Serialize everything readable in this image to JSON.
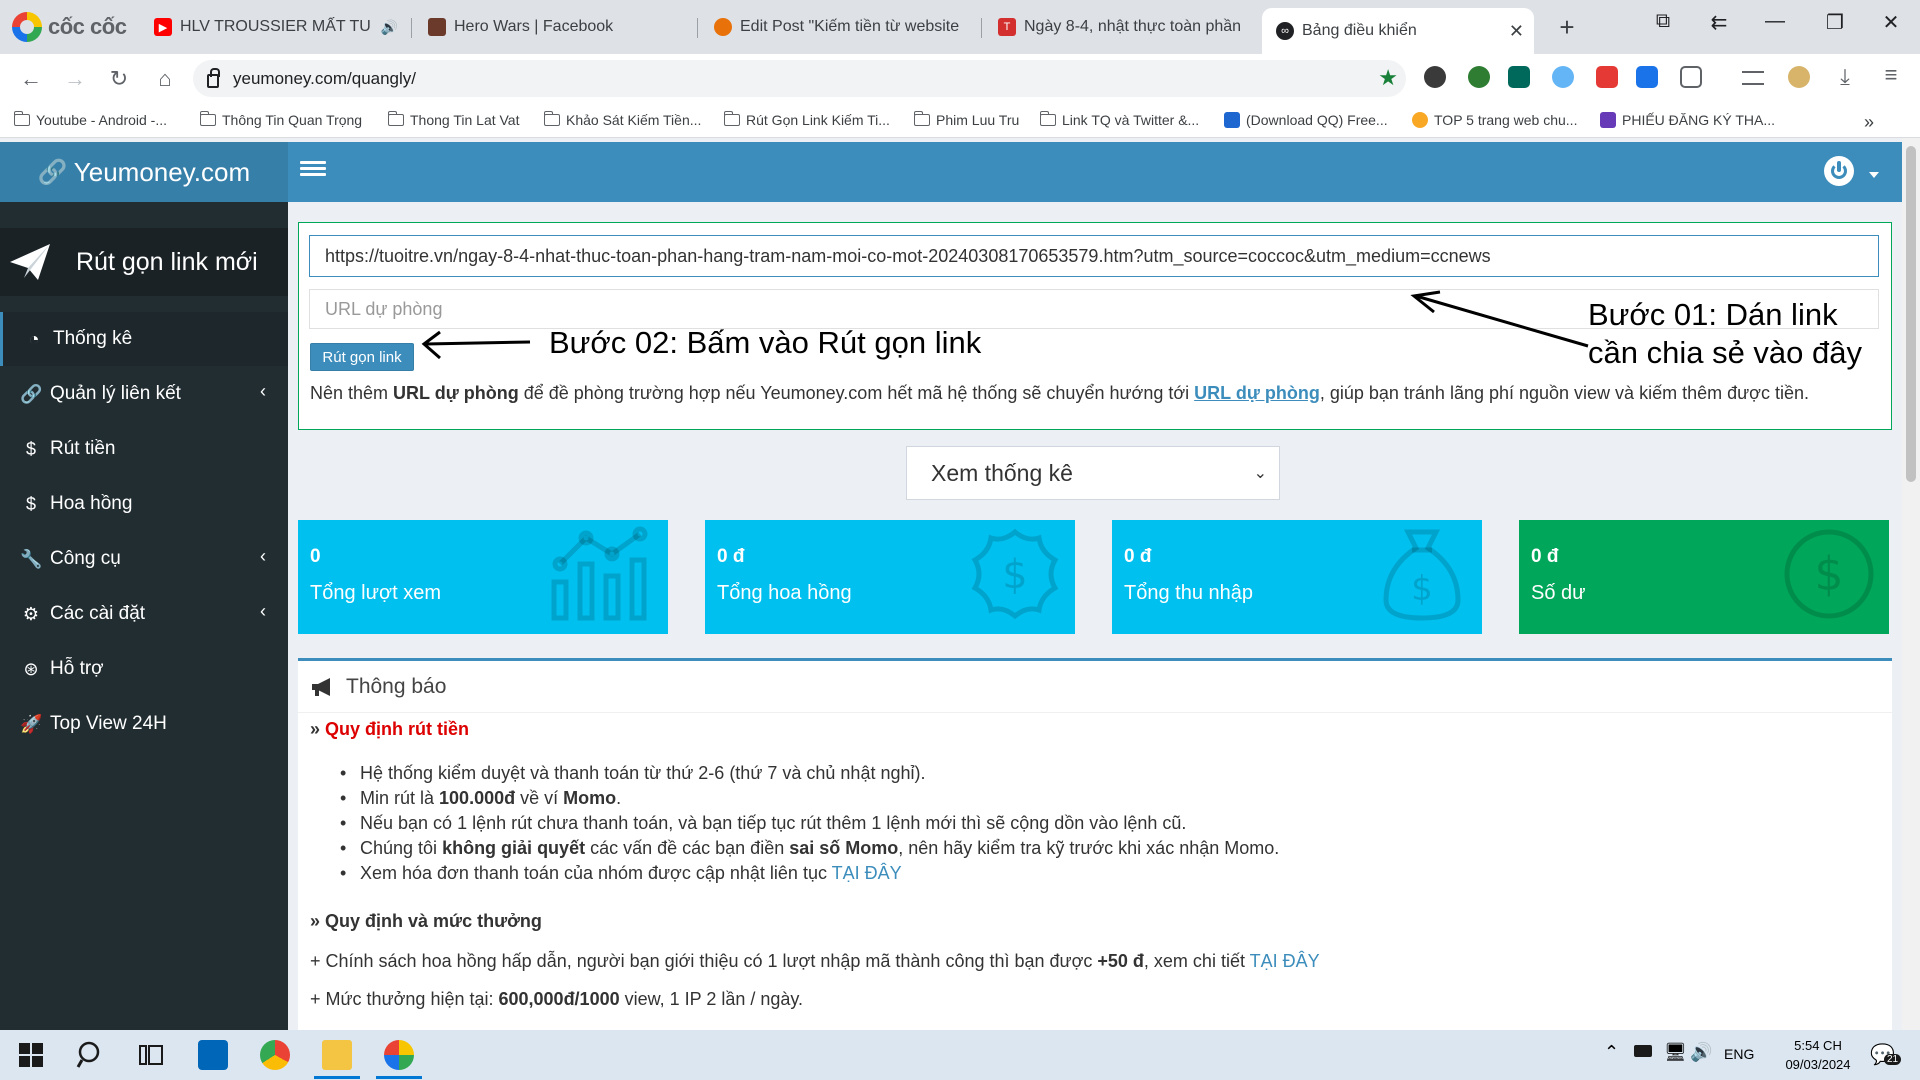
{
  "browser": {
    "brand": "cốc cốc",
    "tabs": [
      {
        "label": "HLV TROUSSIER MẤT TU",
        "icon": "youtube-icon"
      },
      {
        "label": "Hero Wars | Facebook",
        "icon": "hero-wars-icon"
      },
      {
        "label": "Edit Post \"Kiếm tiền từ website",
        "icon": "edit-post-icon"
      },
      {
        "label": "Ngày 8-4, nhật thực toàn phần",
        "icon": "tuoitre-icon"
      },
      {
        "label": "Bảng điều khiển",
        "icon": "yeumoney-icon"
      }
    ],
    "url": "yeumoney.com/quangly/",
    "bookmarks": [
      "Youtube - Android -...",
      "Thông Tin Quan Trọng",
      "Thong Tin Lat Vat",
      "Khảo Sát Kiếm Tiền...",
      "Rút Gọn Link Kiếm Ti...",
      "Phim Luu Tru",
      "Link TQ và Twitter &...",
      "(Download QQ) Free...",
      "TOP 5 trang web chu...",
      "PHIẾU ĐĂNG KÝ THA..."
    ]
  },
  "site": {
    "logo": "Yeumoney.com",
    "new_link": "Rút gọn link mới",
    "menu": [
      {
        "label": "Thống kê",
        "icon": "dashboard-icon",
        "active": true
      },
      {
        "label": "Quản lý liên kết",
        "icon": "link-icon",
        "has_arrow": true
      },
      {
        "label": "Rút tiền",
        "icon": "dollar-icon"
      },
      {
        "label": "Hoa hồng",
        "icon": "dollar-icon"
      },
      {
        "label": "Công cụ",
        "icon": "wrench-icon",
        "has_arrow": true
      },
      {
        "label": "Các cài đặt",
        "icon": "gears-icon",
        "has_arrow": true
      },
      {
        "label": "Hỗ trợ",
        "icon": "lifering-icon"
      },
      {
        "label": "Top View 24H",
        "icon": "rocket-icon"
      }
    ]
  },
  "shorten": {
    "url_value": "https://tuoitre.vn/ngay-8-4-nhat-thuc-toan-phan-hang-tram-nam-moi-co-mot-20240308170653579.htm?utm_source=coccoc&utm_medium=ccnews",
    "backup_placeholder": "URL dự phòng",
    "button": "Rút gọn link",
    "hint_pre": "Nên thêm ",
    "hint_bold": "URL dự phòng",
    "hint_mid": " để đề phòng trường hợp nếu Yeumoney.com hết mã hệ thống sẽ chuyển hướng tới ",
    "hint_link": "URL dự phòng",
    "hint_post": ", giúp bạn tránh lãng phí nguồn view và kiếm thêm được tiền."
  },
  "annotations": {
    "step1_line1": "Bước 01: Dán link",
    "step1_line2": "cần chia sẻ vào đây",
    "step2": "Bước 02: Bấm vào Rút gọn link"
  },
  "stats_select": "Xem thống kê",
  "tiles": [
    {
      "value": "0",
      "label": "Tổng lượt xem",
      "color": "#00c0ef",
      "icon": "bar-chart-icon"
    },
    {
      "value": "0 đ",
      "label": "Tổng hoa hồng",
      "color": "#00c0ef",
      "icon": "dollar-badge-icon"
    },
    {
      "value": "0 đ",
      "label": "Tổng thu nhập",
      "color": "#00c0ef",
      "icon": "money-bag-icon"
    },
    {
      "value": "0 đ",
      "label": "Số dư",
      "color": "#00a65a",
      "icon": "dollar-circle-icon"
    }
  ],
  "notice": {
    "title": "Thông báo",
    "section1_title": "Quy định rút tiền",
    "rules": {
      "r1": "Hệ thống kiểm duyệt và thanh toán từ thứ 2-6 (thứ 7 và chủ nhật nghỉ).",
      "r2_pre": "Min rút là ",
      "r2_bold": "100.000đ",
      "r2_mid": " về ví ",
      "r2_bold2": "Momo",
      "r2_post": ".",
      "r3": "Nếu bạn có 1 lệnh rút chưa thanh toán, và bạn tiếp tục rút thêm 1 lệnh mới thì sẽ cộng dồn vào lệnh cũ.",
      "r4_pre": "Chúng tôi ",
      "r4_bold": "không giải quyết",
      "r4_mid": " các vấn đề các bạn điền ",
      "r4_bold2": "sai số Momo",
      "r4_post": ", nên hãy kiểm tra kỹ trước khi xác nhận Momo.",
      "r5_pre": "Xem hóa đơn thanh toán của nhóm được cập nhật liên tục ",
      "r5_link": "TẠI ĐÂY"
    },
    "section2_title": "Quy định và mức thưởng",
    "p1_pre": "+ Chính sách hoa hồng hấp dẫn, người bạn giới thiệu có 1 lượt nhập mã thành công thì bạn được ",
    "p1_bold": "+50 đ",
    "p1_mid": ", xem chi tiết ",
    "p1_link": "TẠI ĐÂY",
    "p2_pre": "+ Mức thưởng hiện tại: ",
    "p2_bold": "600,000đ/1000",
    "p2_post": " view, 1 IP 2 lần / ngày."
  },
  "taskbar": {
    "lang": "ENG",
    "time": "5:54 CH",
    "date": "09/03/2024",
    "notif_count": "21"
  },
  "colors": {
    "header": "#3c8dbc",
    "sidebar": "#222d32",
    "info": "#00c0ef",
    "success": "#00a65a",
    "danger": "#dd0000"
  }
}
